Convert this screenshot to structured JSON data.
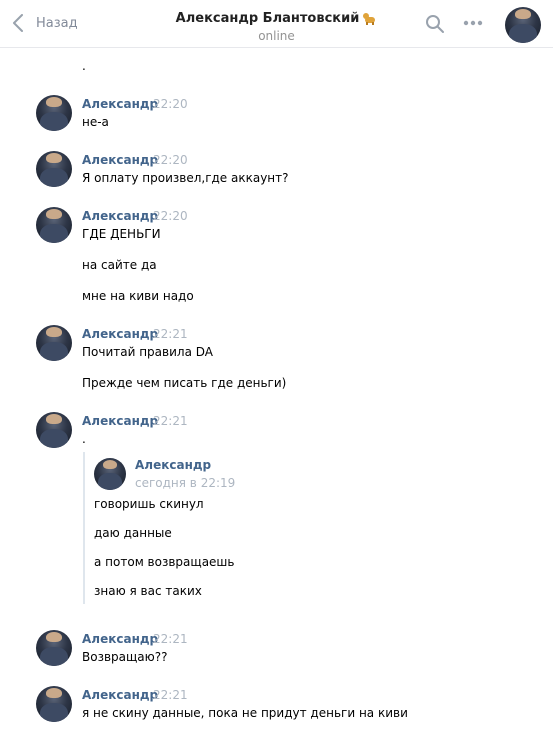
{
  "header": {
    "back_label": "Назад",
    "title": "Александр Блантовский",
    "status": "online"
  },
  "messages": {
    "m0": {
      "line1": "."
    },
    "m1": {
      "author": "Александр",
      "time": "22:20",
      "line1": "не-а"
    },
    "m2": {
      "author": "Александр",
      "time": "22:20",
      "line1": "Я оплату произвел,где аккаунт?"
    },
    "m3": {
      "author": "Александр",
      "time": "22:20",
      "line1": "ГДЕ ДЕНЬГИ",
      "line2": "на сайте да",
      "line3": "мне на киви надо"
    },
    "m4": {
      "author": "Александр",
      "time": "22:21",
      "line1": "Почитай правила DA",
      "line2": "Прежде чем писать где деньги)"
    },
    "m5": {
      "author": "Александр",
      "time": "22:21",
      "line1": ".",
      "forwarded": {
        "author": "Александр",
        "time": "сегодня в 22:19",
        "line1": "говоришь скинул",
        "line2": "даю данные",
        "line3": "а потом возвращаешь",
        "line4": "знаю я вас таких"
      }
    },
    "m6": {
      "author": "Александр",
      "time": "22:21",
      "line1": "Возвращаю??"
    },
    "m7": {
      "author": "Александр",
      "time": "22:21",
      "line1": "я не скину данные, пока не придут деньги на киви"
    }
  },
  "icons": {
    "back": "chevron-left-icon",
    "search": "search-icon",
    "more": "more-icon",
    "title_badge": "dog-emoji-icon"
  },
  "colors": {
    "author": "#42648b",
    "time": "#adb6c1",
    "muted": "#828a99"
  }
}
